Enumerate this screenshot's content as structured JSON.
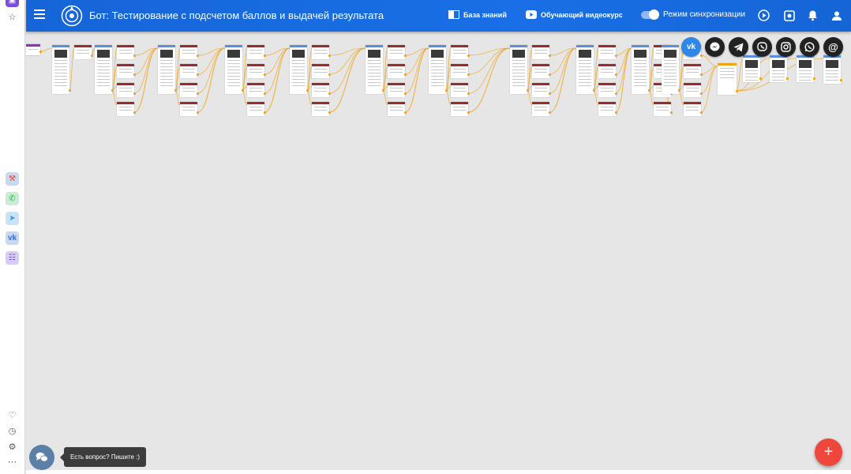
{
  "header": {
    "title": "Бот: Тестирование с подсчетом баллов и выдачей результата",
    "knowledge_base": "База знаний",
    "video_course": "Обучающий видеокурс",
    "sync_mode": "Режим синхронизации"
  },
  "social": [
    {
      "name": "vk",
      "label": "vk",
      "color": "#2f87e8"
    },
    {
      "name": "messenger",
      "label": "",
      "color": "#222222"
    },
    {
      "name": "telegram",
      "label": "",
      "color": "#222222"
    },
    {
      "name": "viber",
      "label": "",
      "color": "#222222"
    },
    {
      "name": "instagram",
      "label": "",
      "color": "#222222"
    },
    {
      "name": "whatsapp",
      "label": "",
      "color": "#222222"
    },
    {
      "name": "email",
      "label": "@",
      "color": "#222222"
    }
  ],
  "rail": {
    "icons": [
      "builder-icon",
      "whatsapp-icon",
      "telegram-icon",
      "vk-icon",
      "chatbot-icon"
    ],
    "bottom_icons": [
      "heart-icon",
      "clock-icon",
      "settings-icon",
      "more-icon"
    ]
  },
  "chat": {
    "tooltip": "Есть вопрос? Пишите :)"
  },
  "fab": {
    "label": "+"
  },
  "colors": {
    "accent": "#1a6fe6",
    "fab": "#f0473d",
    "node_header_blue": "#5a8fe0",
    "node_header_red": "#9e2a2a",
    "connector": "#f2a516"
  }
}
